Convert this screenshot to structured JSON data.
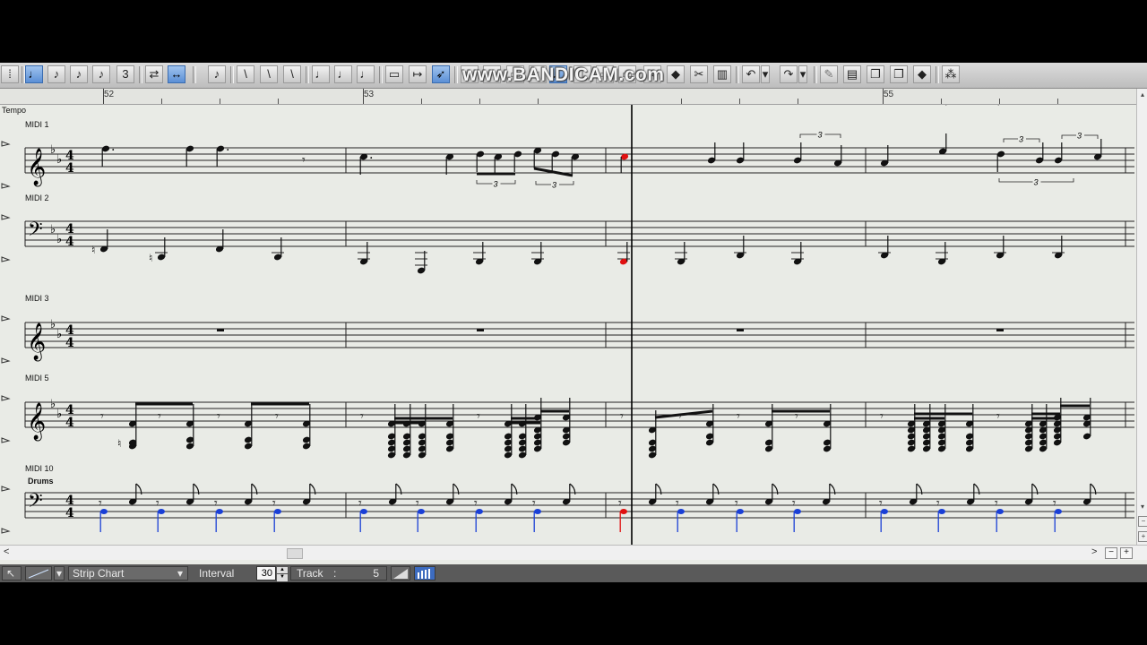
{
  "watermark": "www.BANDICAM.com",
  "ruler": {
    "bars": [
      "52",
      "53",
      "55"
    ]
  },
  "tracks": [
    {
      "label": "MIDI 1",
      "clef": "treble"
    },
    {
      "label": "MIDI 2",
      "clef": "bass"
    },
    {
      "label": "MIDI 3",
      "clef": "treble"
    },
    {
      "label": "MIDI 5",
      "clef": "treble"
    },
    {
      "label": "MIDI 10",
      "clef": "bass",
      "sublabel": "Drums"
    }
  ],
  "tempo_label": "Tempo",
  "time_signature": "4/4",
  "key_signature": "2 flats",
  "tuplet_mark": "3",
  "status": {
    "mode": "Strip Chart",
    "interval_label": "Interval",
    "interval_value": "30",
    "track_label": "Track",
    "track_sep": ":",
    "track_value": "5"
  },
  "scroll": {
    "left_arrow": "<",
    "right_arrow": ">",
    "minus": "−",
    "plus": "+"
  },
  "colors": {
    "playhead": "#000000",
    "current_note": "#e01010",
    "drum_note": "#1a3fd6",
    "background": "#e9ebe6"
  },
  "icons": [
    "select-icon",
    "note-icon",
    "eighth-note-icon",
    "sixteenth-icon",
    "dot-icon",
    "triplet-icon",
    "tie-icon",
    "zoom-icon",
    "metronome-icon",
    "beam-icon",
    "slash-icon",
    "chord-icon",
    "pencil-icon",
    "eraser-icon",
    "undo-icon",
    "redo-icon",
    "wrench-icon",
    "grid-icon"
  ]
}
